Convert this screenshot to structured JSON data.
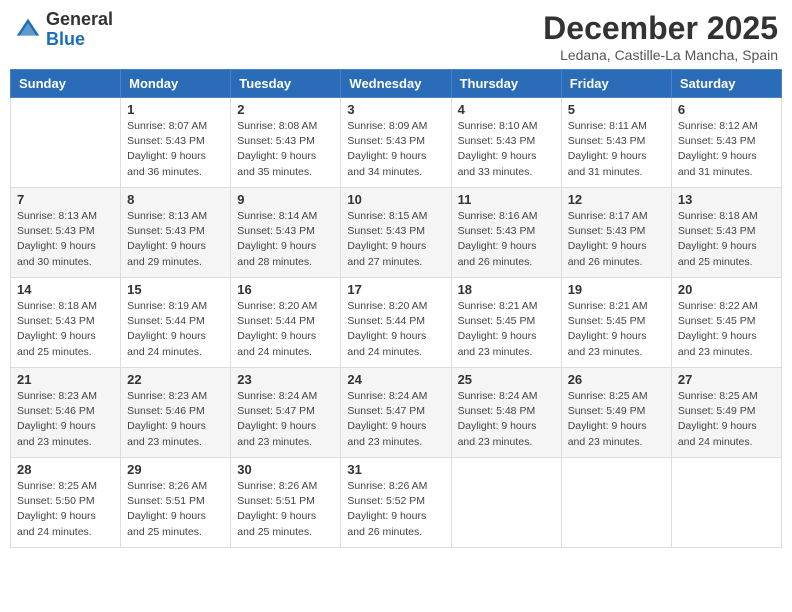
{
  "header": {
    "logo_general": "General",
    "logo_blue": "Blue",
    "month_title": "December 2025",
    "location": "Ledana, Castille-La Mancha, Spain"
  },
  "days_of_week": [
    "Sunday",
    "Monday",
    "Tuesday",
    "Wednesday",
    "Thursday",
    "Friday",
    "Saturday"
  ],
  "weeks": [
    [
      {
        "day": "",
        "sunrise": "",
        "sunset": "",
        "daylight": ""
      },
      {
        "day": "1",
        "sunrise": "Sunrise: 8:07 AM",
        "sunset": "Sunset: 5:43 PM",
        "daylight": "Daylight: 9 hours and 36 minutes."
      },
      {
        "day": "2",
        "sunrise": "Sunrise: 8:08 AM",
        "sunset": "Sunset: 5:43 PM",
        "daylight": "Daylight: 9 hours and 35 minutes."
      },
      {
        "day": "3",
        "sunrise": "Sunrise: 8:09 AM",
        "sunset": "Sunset: 5:43 PM",
        "daylight": "Daylight: 9 hours and 34 minutes."
      },
      {
        "day": "4",
        "sunrise": "Sunrise: 8:10 AM",
        "sunset": "Sunset: 5:43 PM",
        "daylight": "Daylight: 9 hours and 33 minutes."
      },
      {
        "day": "5",
        "sunrise": "Sunrise: 8:11 AM",
        "sunset": "Sunset: 5:43 PM",
        "daylight": "Daylight: 9 hours and 31 minutes."
      },
      {
        "day": "6",
        "sunrise": "Sunrise: 8:12 AM",
        "sunset": "Sunset: 5:43 PM",
        "daylight": "Daylight: 9 hours and 31 minutes."
      }
    ],
    [
      {
        "day": "7",
        "sunrise": "Sunrise: 8:13 AM",
        "sunset": "Sunset: 5:43 PM",
        "daylight": "Daylight: 9 hours and 30 minutes."
      },
      {
        "day": "8",
        "sunrise": "Sunrise: 8:13 AM",
        "sunset": "Sunset: 5:43 PM",
        "daylight": "Daylight: 9 hours and 29 minutes."
      },
      {
        "day": "9",
        "sunrise": "Sunrise: 8:14 AM",
        "sunset": "Sunset: 5:43 PM",
        "daylight": "Daylight: 9 hours and 28 minutes."
      },
      {
        "day": "10",
        "sunrise": "Sunrise: 8:15 AM",
        "sunset": "Sunset: 5:43 PM",
        "daylight": "Daylight: 9 hours and 27 minutes."
      },
      {
        "day": "11",
        "sunrise": "Sunrise: 8:16 AM",
        "sunset": "Sunset: 5:43 PM",
        "daylight": "Daylight: 9 hours and 26 minutes."
      },
      {
        "day": "12",
        "sunrise": "Sunrise: 8:17 AM",
        "sunset": "Sunset: 5:43 PM",
        "daylight": "Daylight: 9 hours and 26 minutes."
      },
      {
        "day": "13",
        "sunrise": "Sunrise: 8:18 AM",
        "sunset": "Sunset: 5:43 PM",
        "daylight": "Daylight: 9 hours and 25 minutes."
      }
    ],
    [
      {
        "day": "14",
        "sunrise": "Sunrise: 8:18 AM",
        "sunset": "Sunset: 5:43 PM",
        "daylight": "Daylight: 9 hours and 25 minutes."
      },
      {
        "day": "15",
        "sunrise": "Sunrise: 8:19 AM",
        "sunset": "Sunset: 5:44 PM",
        "daylight": "Daylight: 9 hours and 24 minutes."
      },
      {
        "day": "16",
        "sunrise": "Sunrise: 8:20 AM",
        "sunset": "Sunset: 5:44 PM",
        "daylight": "Daylight: 9 hours and 24 minutes."
      },
      {
        "day": "17",
        "sunrise": "Sunrise: 8:20 AM",
        "sunset": "Sunset: 5:44 PM",
        "daylight": "Daylight: 9 hours and 24 minutes."
      },
      {
        "day": "18",
        "sunrise": "Sunrise: 8:21 AM",
        "sunset": "Sunset: 5:45 PM",
        "daylight": "Daylight: 9 hours and 23 minutes."
      },
      {
        "day": "19",
        "sunrise": "Sunrise: 8:21 AM",
        "sunset": "Sunset: 5:45 PM",
        "daylight": "Daylight: 9 hours and 23 minutes."
      },
      {
        "day": "20",
        "sunrise": "Sunrise: 8:22 AM",
        "sunset": "Sunset: 5:45 PM",
        "daylight": "Daylight: 9 hours and 23 minutes."
      }
    ],
    [
      {
        "day": "21",
        "sunrise": "Sunrise: 8:23 AM",
        "sunset": "Sunset: 5:46 PM",
        "daylight": "Daylight: 9 hours and 23 minutes."
      },
      {
        "day": "22",
        "sunrise": "Sunrise: 8:23 AM",
        "sunset": "Sunset: 5:46 PM",
        "daylight": "Daylight: 9 hours and 23 minutes."
      },
      {
        "day": "23",
        "sunrise": "Sunrise: 8:24 AM",
        "sunset": "Sunset: 5:47 PM",
        "daylight": "Daylight: 9 hours and 23 minutes."
      },
      {
        "day": "24",
        "sunrise": "Sunrise: 8:24 AM",
        "sunset": "Sunset: 5:47 PM",
        "daylight": "Daylight: 9 hours and 23 minutes."
      },
      {
        "day": "25",
        "sunrise": "Sunrise: 8:24 AM",
        "sunset": "Sunset: 5:48 PM",
        "daylight": "Daylight: 9 hours and 23 minutes."
      },
      {
        "day": "26",
        "sunrise": "Sunrise: 8:25 AM",
        "sunset": "Sunset: 5:49 PM",
        "daylight": "Daylight: 9 hours and 23 minutes."
      },
      {
        "day": "27",
        "sunrise": "Sunrise: 8:25 AM",
        "sunset": "Sunset: 5:49 PM",
        "daylight": "Daylight: 9 hours and 24 minutes."
      }
    ],
    [
      {
        "day": "28",
        "sunrise": "Sunrise: 8:25 AM",
        "sunset": "Sunset: 5:50 PM",
        "daylight": "Daylight: 9 hours and 24 minutes."
      },
      {
        "day": "29",
        "sunrise": "Sunrise: 8:26 AM",
        "sunset": "Sunset: 5:51 PM",
        "daylight": "Daylight: 9 hours and 25 minutes."
      },
      {
        "day": "30",
        "sunrise": "Sunrise: 8:26 AM",
        "sunset": "Sunset: 5:51 PM",
        "daylight": "Daylight: 9 hours and 25 minutes."
      },
      {
        "day": "31",
        "sunrise": "Sunrise: 8:26 AM",
        "sunset": "Sunset: 5:52 PM",
        "daylight": "Daylight: 9 hours and 26 minutes."
      },
      {
        "day": "",
        "sunrise": "",
        "sunset": "",
        "daylight": ""
      },
      {
        "day": "",
        "sunrise": "",
        "sunset": "",
        "daylight": ""
      },
      {
        "day": "",
        "sunrise": "",
        "sunset": "",
        "daylight": ""
      }
    ]
  ]
}
